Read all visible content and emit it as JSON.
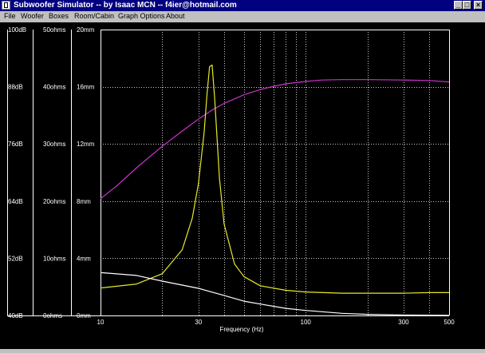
{
  "window": {
    "title": "Subwoofer Simulator -- by Isaac MCN -- f4ier@hotmail.com",
    "controls": [
      "_",
      "□",
      "×"
    ]
  },
  "menu": [
    "File",
    "Woofer",
    "Boxes",
    "Room/Cabin",
    "Graph Options",
    "About"
  ],
  "axes": {
    "db_labels": [
      "100dB",
      "88dB",
      "76dB",
      "64dB",
      "52dB",
      "40dB"
    ],
    "ohm_labels": [
      "50ohms",
      "40ohms",
      "30ohms",
      "20ohms",
      "10ohms",
      "0ohms"
    ],
    "mm_labels": [
      "20mm",
      "16mm",
      "12mm",
      "8mm",
      "4mm",
      "0mm"
    ],
    "x_ticks": [
      "10",
      "30",
      "100",
      "300",
      "500"
    ],
    "x_label": "Frequency (Hz)"
  },
  "colors": {
    "spl": "#cc33cc",
    "impedance": "#e8e82a",
    "excursion": "#ffffff",
    "grid": "#c8c8c8"
  },
  "chart_data": {
    "type": "line",
    "x_scale": "log",
    "xlim": [
      10,
      500
    ],
    "xlabel": "Frequency (Hz)",
    "y_axes": [
      {
        "unit": "dB",
        "range": [
          40,
          100
        ]
      },
      {
        "unit": "ohms",
        "range": [
          0,
          50
        ]
      },
      {
        "unit": "mm",
        "range": [
          0,
          20
        ]
      }
    ],
    "series": [
      {
        "unit": "dB",
        "x": [
          10,
          12,
          15,
          20,
          25,
          30,
          35,
          40,
          50,
          60,
          70,
          80,
          100,
          120,
          150,
          200,
          300,
          400,
          500
        ],
        "values": [
          64.5,
          67.2,
          71,
          75.5,
          78.7,
          81.2,
          83.1,
          84.5,
          86.3,
          87.4,
          88.1,
          88.6,
          89.1,
          89.4,
          89.5,
          89.5,
          89.4,
          89.3,
          89
        ]
      },
      {
        "unit": "ohms",
        "x": [
          10,
          15,
          20,
          25,
          28,
          30,
          32,
          33,
          34,
          35,
          36,
          37,
          38,
          40,
          45,
          50,
          60,
          80,
          100,
          150,
          200,
          300,
          400,
          500
        ],
        "values": [
          4.8,
          5.5,
          7.3,
          11.5,
          17,
          23,
          32,
          38.5,
          43.5,
          43.8,
          38,
          31,
          24,
          16,
          9,
          6.8,
          5.2,
          4.4,
          4.1,
          3.9,
          3.9,
          3.9,
          4.0,
          4.0
        ]
      },
      {
        "unit": "mm",
        "x": [
          10,
          15,
          20,
          30,
          40,
          50,
          60,
          80,
          100,
          150,
          200,
          300,
          500
        ],
        "values": [
          3,
          2.8,
          2.4,
          1.9,
          1.4,
          1.0,
          0.8,
          0.5,
          0.35,
          0.15,
          0.08,
          0.03,
          0.01
        ]
      }
    ]
  }
}
